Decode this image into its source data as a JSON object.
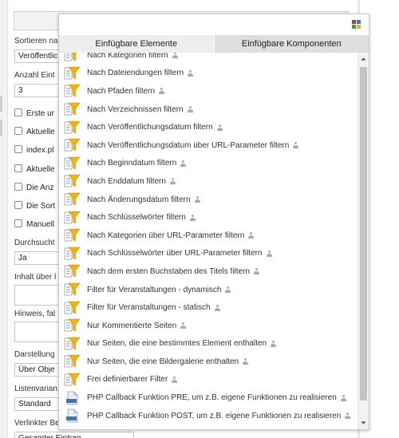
{
  "form": {
    "sort_label": "Sortieren na",
    "sort_value": "Veröffentlic",
    "count_label": "Anzahl Eint",
    "count_value": "3",
    "checkboxes": [
      "Erste ur",
      "Aktuelle",
      "index.pl",
      "Aktuelle",
      "Die Anz",
      "Die Sort",
      "Manuell"
    ],
    "search_label": "Durchsucht",
    "search_value": "Ja",
    "content_label": "Inhalt über l",
    "hint_label": "Hinweis, fal",
    "display_label": "Darstellung",
    "display_value": "Über Obje",
    "variant_label": "Listenvarian",
    "variant_value": "Standard",
    "linked_label": "Verlinkter Bereich",
    "linked_value": "Gesamter Eintrag"
  },
  "popup": {
    "tabs": [
      {
        "label": "Einfügbare Elemente"
      },
      {
        "label": "Einfügbare Komponenten"
      }
    ],
    "items": [
      {
        "label": "Nach Kategorien filtern",
        "icon": "filter-icon"
      },
      {
        "label": "Nach Dateiendungen filtern",
        "icon": "filter-icon"
      },
      {
        "label": "Nach Pfaden filtern",
        "icon": "filter-icon"
      },
      {
        "label": "Nach Verzeichnissen filtern",
        "icon": "filter-icon"
      },
      {
        "label": "Nach Veröffentlichungsdatum filtern",
        "icon": "filter-icon"
      },
      {
        "label": "Nach Veröffentlichungsdatum über URL-Parameter filtern",
        "icon": "filter-icon"
      },
      {
        "label": "Nach Beginndatum filtern",
        "icon": "filter-icon"
      },
      {
        "label": "Nach Enddatum filtern",
        "icon": "filter-icon"
      },
      {
        "label": "Nach Änderungsdatum filtern",
        "icon": "filter-icon"
      },
      {
        "label": "Nach Schlüsselwörter filtern",
        "icon": "filter-icon"
      },
      {
        "label": "Nach Kategorien über URL-Parameter filtern",
        "icon": "filter-icon"
      },
      {
        "label": "Nach Schlüsselwörter über URL-Parameter filtern",
        "icon": "filter-icon"
      },
      {
        "label": "Nach dem ersten Buchstaben des Titels filtern",
        "icon": "filter-icon"
      },
      {
        "label": "Filter für Veranstaltungen - dynamisch",
        "icon": "filter-icon"
      },
      {
        "label": "Filter für Veranstaltungen - statisch",
        "icon": "filter-icon"
      },
      {
        "label": "Nur Kommentierte Seiten",
        "icon": "filter-icon"
      },
      {
        "label": "Nur Seiten, die eine bestimmtes Element enthalten",
        "icon": "filter-icon"
      },
      {
        "label": "Nur Seiten, die eine Bildergalerie enthalten",
        "icon": "filter-icon"
      },
      {
        "label": "Frei definierbarer Filter",
        "icon": "filter-icon"
      },
      {
        "label": "PHP Callback Funktion PRE, um z.B. eigene Funktionen zu realisieren",
        "icon": "php-file-icon"
      },
      {
        "label": "PHP Callback Funktion POST, um z.B. eigene Funktionen zu realisieren",
        "icon": "php-file-icon"
      }
    ],
    "colors": {
      "funnel": "#f2b315",
      "php": "#4a6fb5",
      "grid": [
        "#d9312b",
        "#3a7bd5",
        "#3aa14a",
        "#f0b400"
      ]
    }
  }
}
